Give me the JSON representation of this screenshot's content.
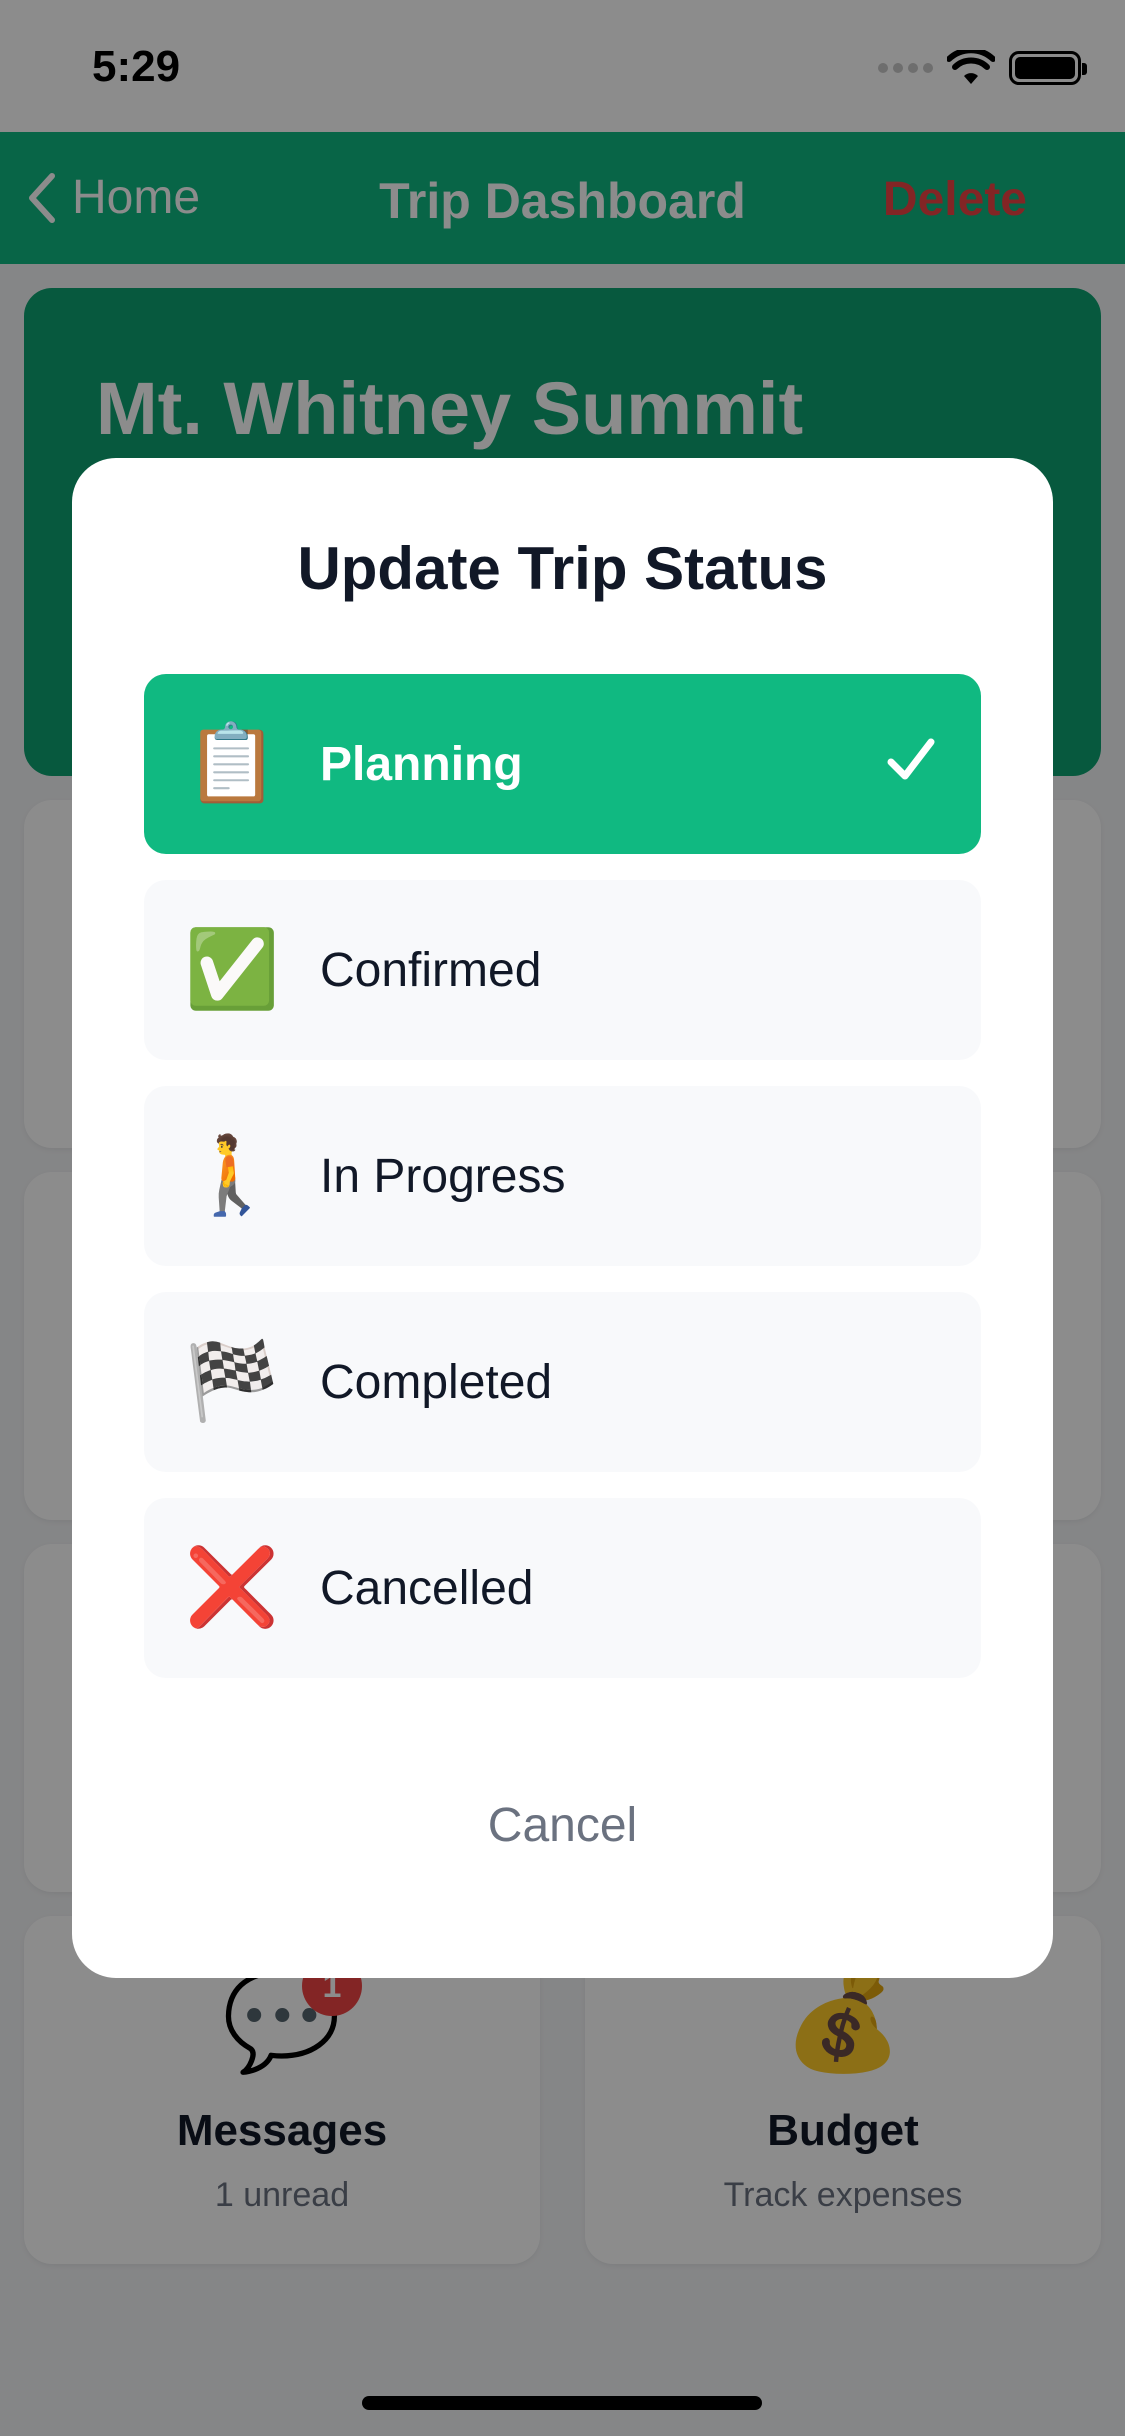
{
  "status_bar": {
    "time": "5:29"
  },
  "nav": {
    "back_label": "Home",
    "title": "Trip Dashboard",
    "delete_label": "Delete"
  },
  "trip": {
    "title": "Mt. Whitney Summit"
  },
  "tiles": {
    "messages": {
      "icon": "💬",
      "title": "Messages",
      "subtitle": "1 unread",
      "badge": "1"
    },
    "budget": {
      "icon": "💰",
      "title": "Budget",
      "subtitle": "Track expenses"
    }
  },
  "modal": {
    "title": "Update Trip Status",
    "options": [
      {
        "icon": "📋",
        "label": "Planning",
        "selected": true
      },
      {
        "icon": "✅",
        "label": "Confirmed",
        "selected": false
      },
      {
        "icon": "🚶",
        "label": "In Progress",
        "selected": false
      },
      {
        "icon": "🏁",
        "label": "Completed",
        "selected": false
      },
      {
        "icon": "❌",
        "label": "Cancelled",
        "selected": false
      }
    ],
    "cancel_label": "Cancel"
  },
  "colors": {
    "accent": "#10b981",
    "delete": "#ef4444",
    "option_bg": "#f8f9fb",
    "text_dark": "#111827",
    "text_muted": "#6b7280"
  }
}
